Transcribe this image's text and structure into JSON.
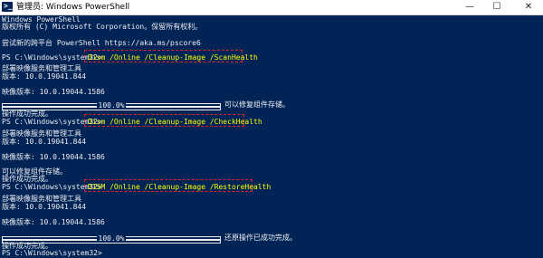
{
  "window": {
    "title": "管理员: Windows PowerShell",
    "min_label": "—",
    "max_label": "☐",
    "close_label": "✕"
  },
  "console": {
    "l1": "Windows PowerShell",
    "l2": "版权所有 (C) Microsoft Corporation。保留所有权利。",
    "l3": "尝试新的跨平台 PowerShell https://aka.ms/pscore6",
    "prompt": "PS C:\\Windows\\system32>",
    "cmd1": "Dism /Online /Cleanup-Image /ScanHealth",
    "tool": "部署映像服务和管理工具",
    "version": "版本: 10.0.19041.844",
    "image_version": "映像版本: 10.0.19044.1586",
    "progress_text": "100.0%",
    "progress_value": 1.0,
    "repairable": "可以修复组件存储。",
    "success": "操作成功完成。",
    "cmd2": "Dism /Online /Cleanup-Image /CheckHealth",
    "cmd3": "DISM /Online /Cleanup-Image /RestoreHealth",
    "restore_done": "还原操作已成功完成。"
  },
  "colors": {
    "background": "#012456",
    "text": "#eeedf0",
    "command": "#ffff00",
    "highlight_box": "#e0242c"
  }
}
